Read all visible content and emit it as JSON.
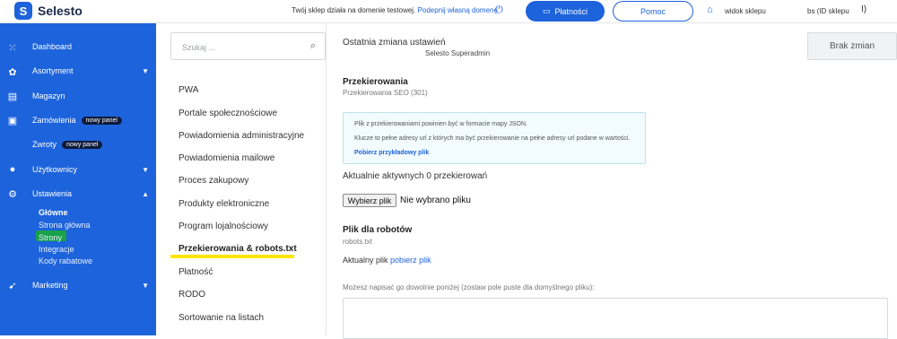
{
  "app": {
    "name": "Selesto",
    "notice_text": "Twój sklep działa na domenie testowej.",
    "notice_link": "Podepnij własną domenę",
    "payments_label": "Płatności",
    "help_label": "Pomoc",
    "shop_view_label": "widok sklepu",
    "account_label": "bs (ID sklepu",
    "power_label": "I)"
  },
  "sidebar": {
    "items": [
      {
        "label": "Dashboard"
      },
      {
        "label": "Asortyment"
      },
      {
        "label": "Magazyn"
      },
      {
        "label": "Zamówienia",
        "badge": "nowy panel"
      },
      {
        "label": "Zwroty",
        "badge": "nowy panel"
      },
      {
        "label": "Użytkownicy"
      },
      {
        "label": "Ustawienia"
      },
      {
        "label": "Marketing"
      }
    ],
    "subitems": [
      "Główne",
      "Strona główna",
      "Strony",
      "Integracje",
      "Kody rabatowe"
    ]
  },
  "search": {
    "placeholder": "Szukaj ..."
  },
  "settings_menu": [
    "PWA",
    "Portale społecznościowe",
    "Powiadomienia administracyjne",
    "Powiadomienia mailowe",
    "Proces zakupowy",
    "Produkty elektroniczne",
    "Program lojalnościowy",
    "Przekierowania & robots.txt",
    "Płatność",
    "RODO",
    "Sortowanie na listach"
  ],
  "content": {
    "last_change_label": "Ostatnia zmiana ustawień",
    "last_change_user": "Selesto Superadmin",
    "no_changes_button": "Brak zmian",
    "redirects_title": "Przekierowania",
    "redirects_sub": "Przekierowania SEO (301)",
    "info_line1": "Plik z przekierowaniami powinien być w formacie mapy JSON.",
    "info_line2": "Klucze to pełne adresy url z których ma być przekierowanie na pełne adresy url podane w wartości.",
    "info_link": "Pobierz przykładowy plik",
    "active_count": "Aktualnie aktywnych 0 przekierowań",
    "file_button": "Wybierz plik",
    "file_none": "Nie wybrano pliku",
    "robots_title": "Plik dla robotów",
    "robots_sub": "robots.txt",
    "current_file_label": "Aktualny plik",
    "current_file_link": "pobierz plik",
    "hint": "Możesz napisać go dowolnie poniżej (zostaw pole puste dla domyślnego pliku):"
  },
  "colors": {
    "brand": "#1d63dc",
    "highlight": "#ffe600",
    "active_sub": "#1aa14a"
  }
}
